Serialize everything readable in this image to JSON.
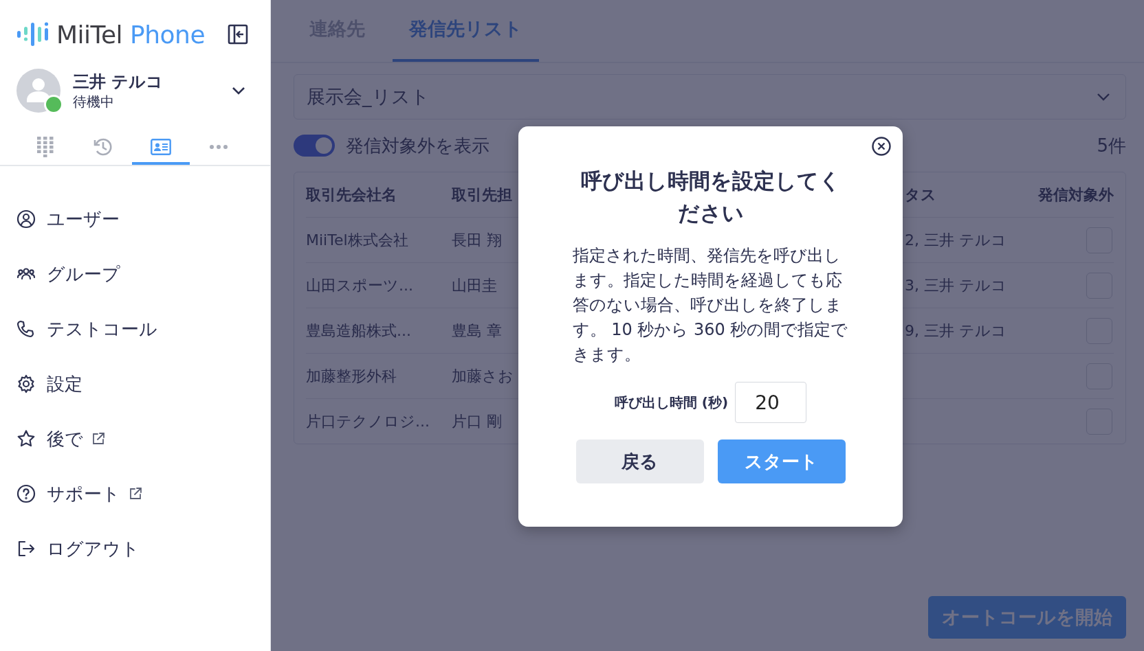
{
  "sidebar": {
    "logo": {
      "text_dark": "MiiTel",
      "text_accent": "Phone"
    },
    "user": {
      "name": "三井 テルコ",
      "status": "待機中",
      "online": true
    },
    "nav_tabs": [
      {
        "kind": "dialpad",
        "selected": false
      },
      {
        "kind": "history",
        "selected": false
      },
      {
        "kind": "contacts",
        "selected": true
      },
      {
        "kind": "more",
        "selected": false
      }
    ],
    "menu": [
      {
        "kind": "user",
        "label": "ユーザー",
        "external": false
      },
      {
        "kind": "group",
        "label": "グループ",
        "external": false
      },
      {
        "kind": "phone",
        "label": "テストコール",
        "external": false
      },
      {
        "kind": "settings",
        "label": "設定",
        "external": false
      },
      {
        "kind": "star",
        "label": "後で",
        "external": true
      },
      {
        "kind": "help",
        "label": "サポート",
        "external": true
      },
      {
        "kind": "logout",
        "label": "ログアウト",
        "external": false
      }
    ]
  },
  "main": {
    "tabs": [
      {
        "label": "連絡先",
        "selected": false
      },
      {
        "label": "発信先リスト",
        "selected": true
      }
    ],
    "list_select": {
      "value": "展示会_リスト"
    },
    "toggle": {
      "label": "発信対象外を表示",
      "on": true
    },
    "count": "5件",
    "table": {
      "columns": [
        "取引先会社名",
        "取引先担",
        "タス",
        "発信対象外"
      ],
      "rows": [
        {
          "company": "MiiTel株式会社",
          "contact": "長田 翔",
          "status": "2, 三井 テルコ",
          "excluded": false
        },
        {
          "company": "山田スポーツ...",
          "contact": "山田圭",
          "status": "3, 三井 テルコ",
          "excluded": false
        },
        {
          "company": "豊島造船株式...",
          "contact": "豊島 章",
          "status": "9, 三井 テルコ",
          "excluded": false
        },
        {
          "company": "加藤整形外科",
          "contact": "加藤さお",
          "status": "",
          "excluded": false
        },
        {
          "company": "片口テクノロジ...",
          "contact": "片口 剛",
          "status": "",
          "excluded": false
        }
      ]
    },
    "start_button": {
      "label": "オートコールを開始"
    }
  },
  "dialog": {
    "title": "呼び出し時間を設定してください",
    "body": "指定された時間、発信先を呼び出します。指定した時間を経過しても応答のない場合、呼び出しを終了します。 10 秒から 360 秒の間で指定できます。",
    "field_label": "呼び出し時間 (秒)",
    "field_value": "20",
    "buttons": [
      {
        "kind": "secondary",
        "label": "戻る"
      },
      {
        "kind": "primary",
        "label": "スタート"
      }
    ]
  }
}
